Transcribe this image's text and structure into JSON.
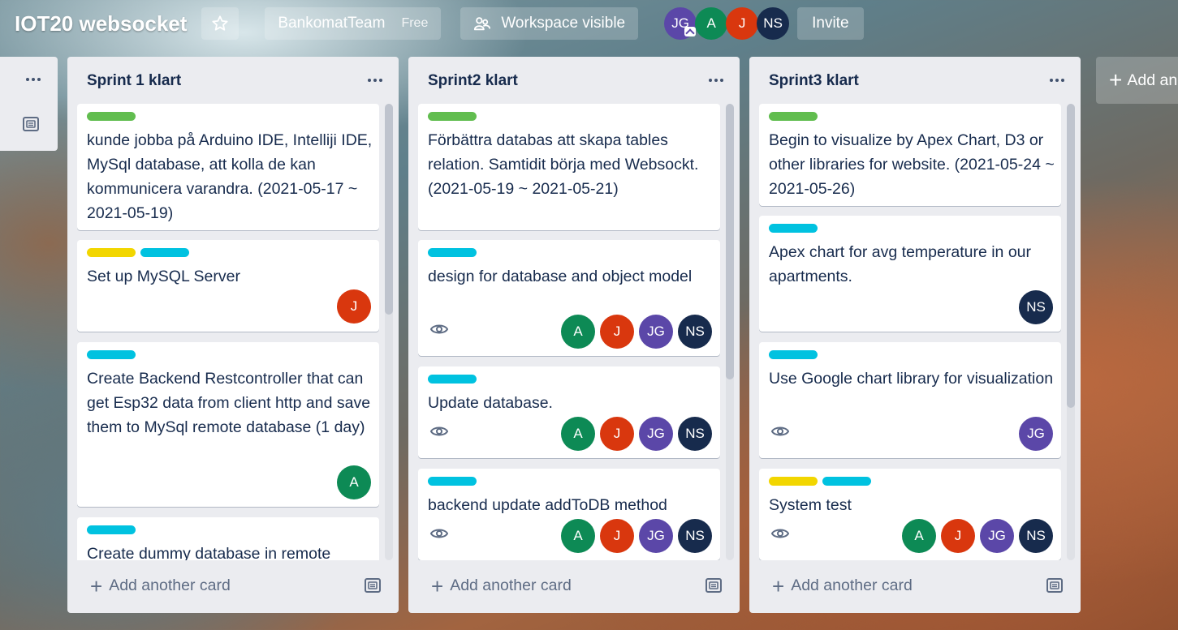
{
  "header": {
    "board_title": "IOT20 websocket",
    "team_name": "BankomatTeam",
    "plan": "Free",
    "visibility": "Workspace visible",
    "members": [
      "JG",
      "A",
      "J",
      "NS"
    ],
    "invite": "Invite"
  },
  "lists": [
    {
      "title": "Sprint 1 klart",
      "cards": [
        {
          "labels": [
            "green"
          ],
          "title": "kunde jobba på Arduino IDE, Intelliji IDE, MySql database, att kolla de kan kommunicera varandra. (2021-05-17 ~ 2021-05-19)",
          "members": []
        },
        {
          "labels": [
            "yellow",
            "sky"
          ],
          "title": "Set up MySQL Server",
          "members": [
            "J"
          ]
        },
        {
          "labels": [
            "sky"
          ],
          "title": "Create Backend Restcontroller that can get Esp32 data from client http and save them to MySql remote database (1 day)",
          "members": [
            "A"
          ]
        },
        {
          "labels": [
            "sky"
          ],
          "title": "Create dummy database in remote",
          "members": []
        }
      ],
      "add_card": "Add another card"
    },
    {
      "title": "Sprint2 klart",
      "cards": [
        {
          "labels": [
            "green"
          ],
          "title": "Förbättra databas att skapa tables relation. Samtidit börja med Websockt. (2021-05-19 ~ 2021-05-21)",
          "members": []
        },
        {
          "labels": [
            "sky"
          ],
          "title": "design for database and object model",
          "watch": true,
          "members": [
            "A",
            "J",
            "JG",
            "NS"
          ]
        },
        {
          "labels": [
            "sky"
          ],
          "title": "Update database.",
          "watch": true,
          "members": [
            "A",
            "J",
            "JG",
            "NS"
          ]
        },
        {
          "labels": [
            "sky"
          ],
          "title": "backend update addToDB method",
          "watch": true,
          "members": [
            "A",
            "J",
            "JG",
            "NS"
          ]
        }
      ],
      "add_card": "Add another card"
    },
    {
      "title": "Sprint3 klart",
      "cards": [
        {
          "labels": [
            "green"
          ],
          "title": "Begin to visualize by Apex Chart, D3 or other libraries for website. (2021-05-24 ~ 2021-05-26)",
          "members": []
        },
        {
          "labels": [
            "sky"
          ],
          "title": "Apex chart for avg temperature in our apartments.",
          "members": [
            "NS"
          ]
        },
        {
          "labels": [
            "sky"
          ],
          "title": "Use Google chart library for visualization",
          "watch": true,
          "members": [
            "JG"
          ]
        },
        {
          "labels": [
            "yellow",
            "sky"
          ],
          "title": "System test",
          "watch": true,
          "members": [
            "A",
            "J",
            "JG",
            "NS"
          ]
        }
      ],
      "add_card": "Add another card"
    }
  ],
  "add_list": "Add another list",
  "colors": {
    "label_green": "#61bd4f",
    "label_yellow": "#f2d600",
    "label_sky": "#00c2e0",
    "member_A": "#0d8a55",
    "member_J": "#d9370e",
    "member_JG": "#5b47a8",
    "member_NS": "#172b4d"
  }
}
